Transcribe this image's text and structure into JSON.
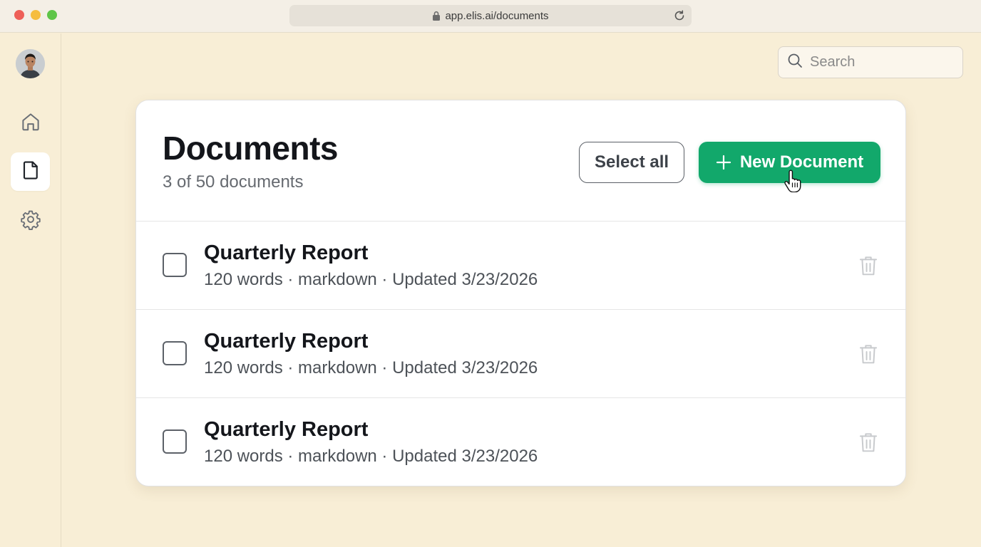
{
  "browser": {
    "url": "app.elis.ai/documents"
  },
  "sidebar": {
    "items": [
      {
        "icon": "home-icon",
        "active": false
      },
      {
        "icon": "document-icon",
        "active": true
      },
      {
        "icon": "gear-icon",
        "active": false
      }
    ]
  },
  "search": {
    "placeholder": "Search",
    "value": ""
  },
  "documents_page": {
    "title": "Documents",
    "subtitle": "3 of 50 documents",
    "select_all_label": "Select all",
    "new_document_label": "New Document",
    "accent_color": "#12a86b"
  },
  "documents": [
    {
      "title": "Quarterly Report",
      "meta": "120 words · markdown · Updated 3/23/2026",
      "checked": false
    },
    {
      "title": "Quarterly Report",
      "meta": "120 words · markdown · Updated 3/23/2026",
      "checked": false
    },
    {
      "title": "Quarterly Report",
      "meta": "120 words · markdown · Updated 3/23/2026",
      "checked": false
    }
  ]
}
